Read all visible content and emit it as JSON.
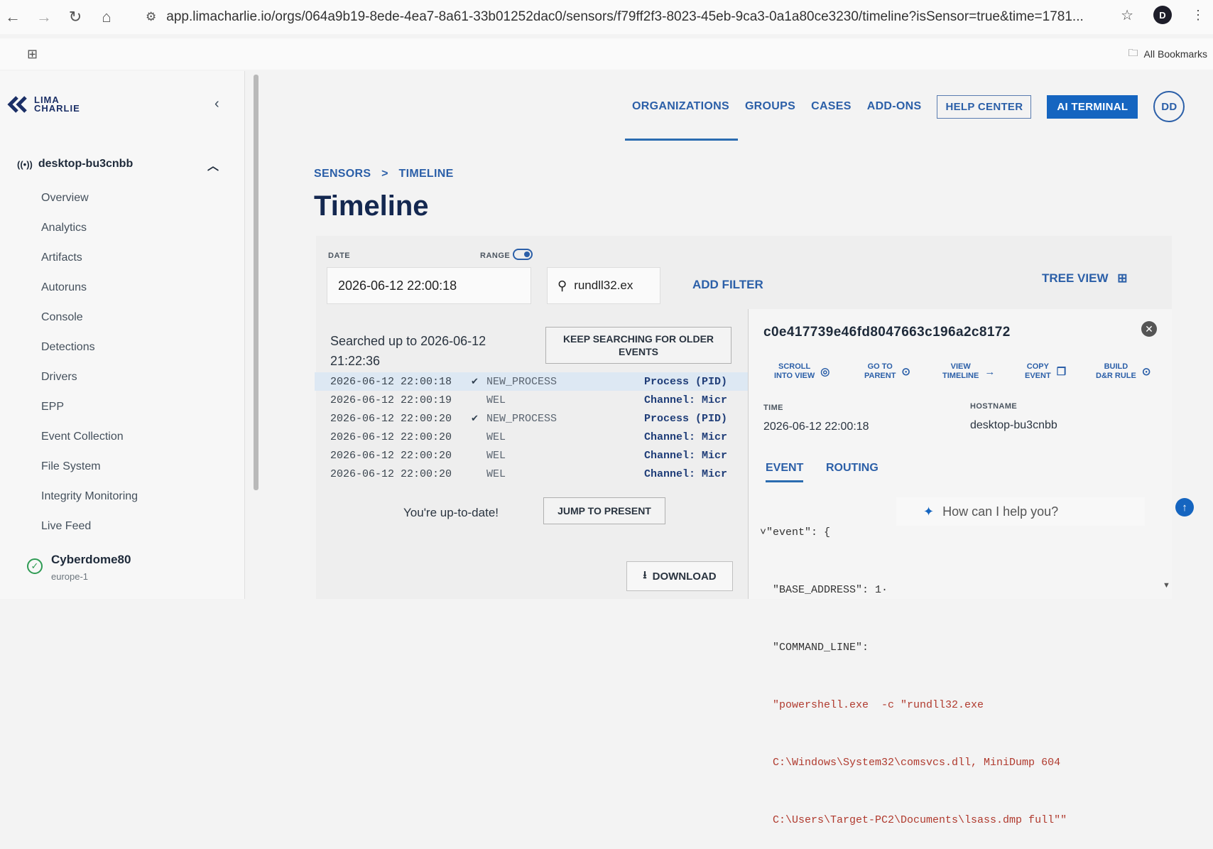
{
  "browser": {
    "url": "app.limacharlie.io/orgs/064a9b19-8ede-4ea7-8a61-33b01252dac0/sensors/f79ff2f3-8023-45eb-9ca3-0a1a80ce3230/timeline?isSensor=true&time=1781...",
    "profile_initial": "D",
    "bookmarks_label": "All Bookmarks"
  },
  "logo": {
    "line1": "LIMA",
    "line2": "CHARLIE"
  },
  "sidebar": {
    "sensor_name": "desktop-bu3cnbb",
    "items": [
      "Overview",
      "Analytics",
      "Artifacts",
      "Autoruns",
      "Console",
      "Detections",
      "Drivers",
      "EPP",
      "Event Collection",
      "File System",
      "Integrity Monitoring",
      "Live Feed"
    ],
    "org_name": "Cyberdome80",
    "org_region": "europe-1"
  },
  "topnav": {
    "organizations": "ORGANIZATIONS",
    "groups": "GROUPS",
    "cases": "CASES",
    "addons": "ADD-ONS",
    "help_center": "HELP CENTER",
    "ai_terminal": "AI TERMINAL",
    "avatar": "DD"
  },
  "breadcrumb": {
    "sensors": "SENSORS",
    "sep": ">",
    "timeline": "TIMELINE"
  },
  "page_title": "Timeline",
  "filters": {
    "date_label": "DATE",
    "range_label": "RANGE",
    "date_value": "2026-06-12 22:00:18",
    "search_value": "rundll32.ex",
    "add_filter": "ADD FILTER",
    "tree_view": "TREE VIEW"
  },
  "results": {
    "searched_text": "Searched up to 2026-06-12 21:22:36",
    "keep_searching": "KEEP SEARCHING FOR OLDER EVENTS",
    "rows": [
      {
        "time": "2026-06-12 22:00:18",
        "check": "✔",
        "event": "NEW_PROCESS",
        "detail": "Process (PID)"
      },
      {
        "time": "2026-06-12 22:00:19",
        "check": "",
        "event": "WEL",
        "detail": "Channel: Micr"
      },
      {
        "time": "2026-06-12 22:00:20",
        "check": "✔",
        "event": "NEW_PROCESS",
        "detail": "Process (PID)"
      },
      {
        "time": "2026-06-12 22:00:20",
        "check": "",
        "event": "WEL",
        "detail": "Channel: Micr"
      },
      {
        "time": "2026-06-12 22:00:20",
        "check": "",
        "event": "WEL",
        "detail": "Channel: Micr"
      },
      {
        "time": "2026-06-12 22:00:20",
        "check": "",
        "event": "WEL",
        "detail": "Channel: Micr"
      }
    ],
    "up_to_date": "You're up-to-date!",
    "jump_to_present": "JUMP TO PRESENT",
    "download": "DOWNLOAD"
  },
  "detail": {
    "hash": "c0e417739e46fd8047663c196a2c8172",
    "actions": [
      {
        "l1": "SCROLL",
        "l2": "INTO VIEW",
        "icon": "◎"
      },
      {
        "l1": "GO TO",
        "l2": "PARENT",
        "icon": "⊙"
      },
      {
        "l1": "VIEW",
        "l2": "TIMELINE",
        "icon": "→"
      },
      {
        "l1": "COPY",
        "l2": "EVENT",
        "icon": "❐"
      },
      {
        "l1": "BUILD",
        "l2": "D&R RULE",
        "icon": "⊙"
      }
    ],
    "time_label": "TIME",
    "time_value": "2026-06-12 22:00:18",
    "host_label": "HOSTNAME",
    "host_value": "desktop-bu3cnbb",
    "tab_event": "EVENT",
    "tab_routing": "ROUTING",
    "json_lines": [
      "˅\"event\": {",
      "  \"BASE_ADDRESS\": 1·",
      "  \"COMMAND_LINE\":"
    ],
    "json_string_lines": [
      "  \"powershell.exe  -c \"rundll32.exe",
      "  C:\\Windows\\System32\\comsvcs.dll, MiniDump 604",
      "  C:\\Users\\Target-PC2\\Documents\\lsass.dmp full\"\""
    ],
    "chat_placeholder": "How can I help you?"
  }
}
